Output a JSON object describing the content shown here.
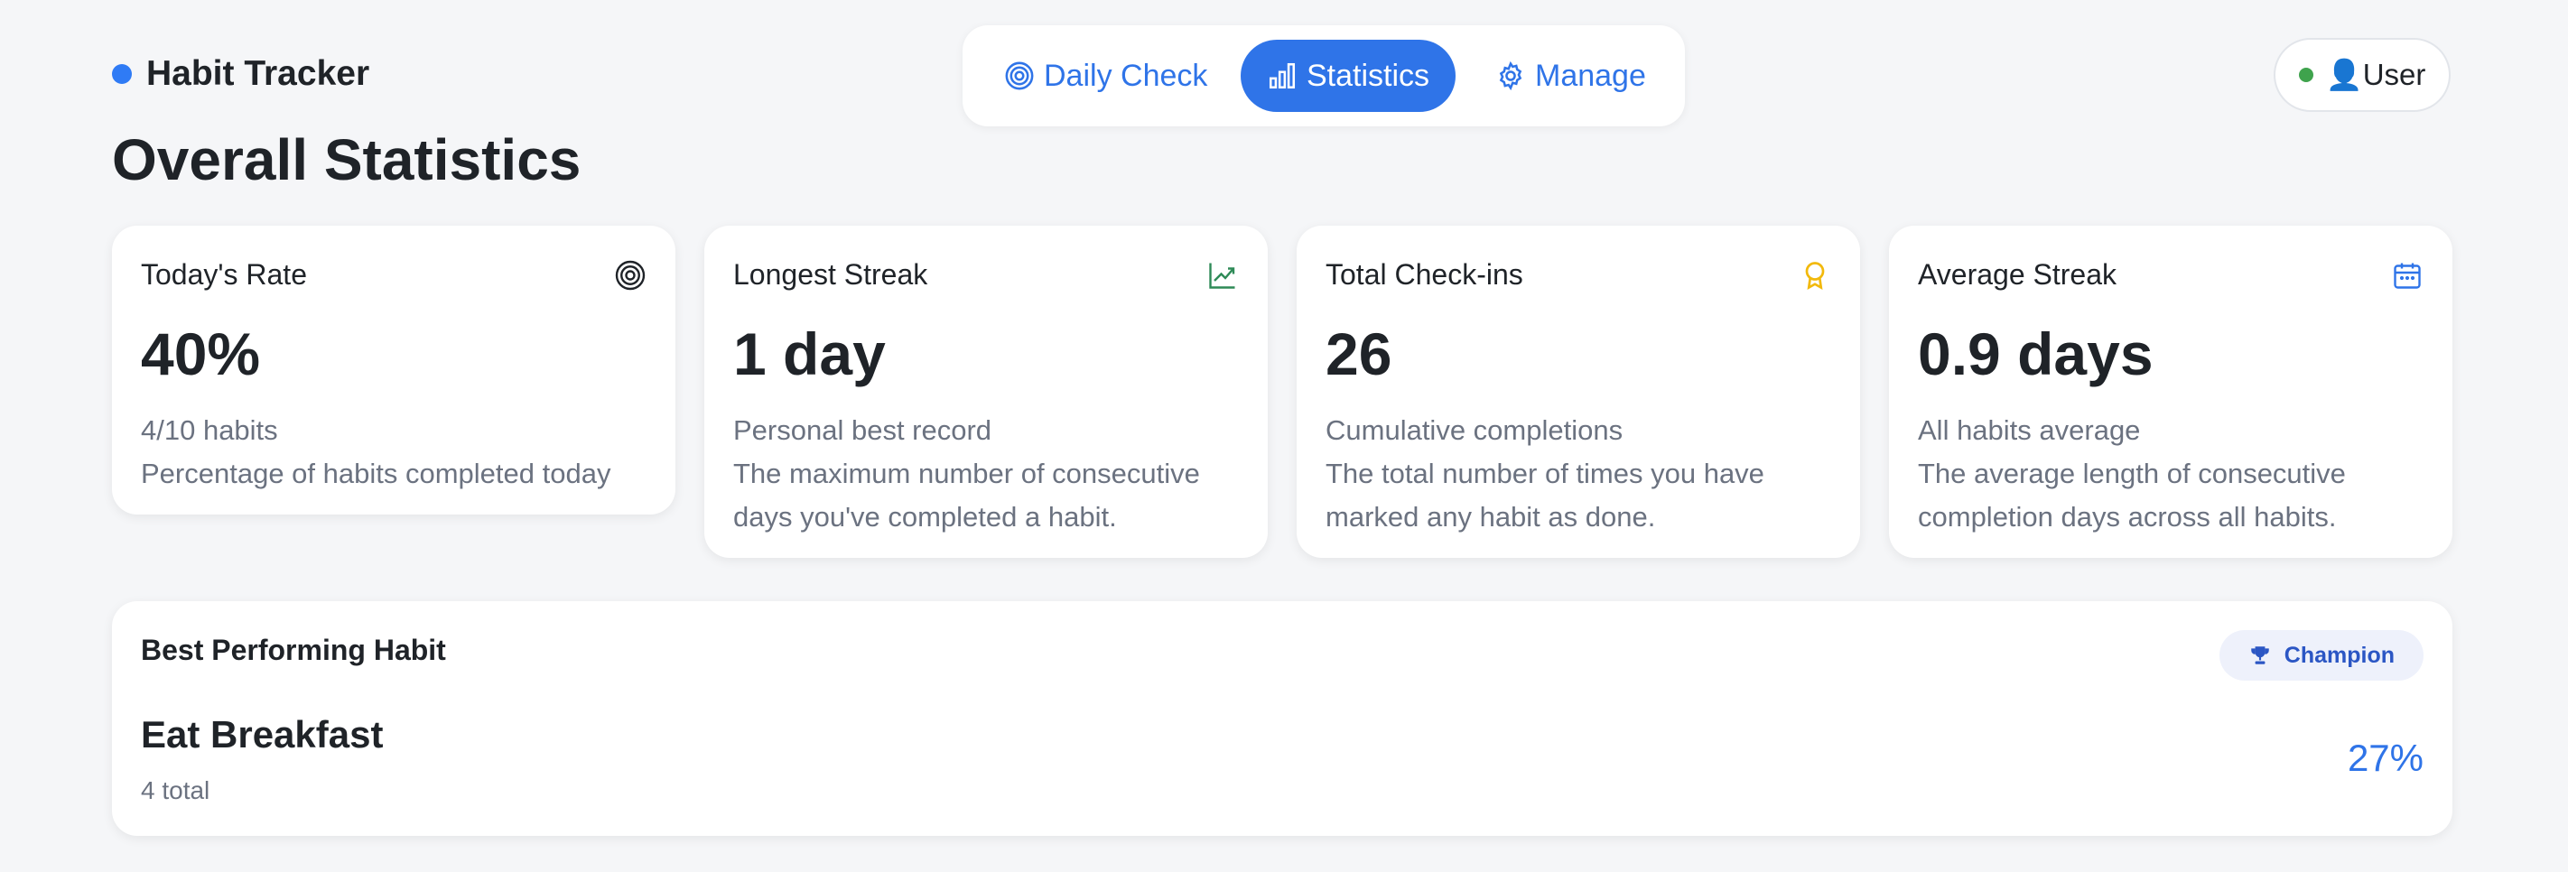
{
  "brand": {
    "name": "Habit Tracker",
    "accent": "#2f7bf5"
  },
  "nav": {
    "tabs": [
      {
        "label": "Daily Check",
        "icon": "target-icon",
        "active": false
      },
      {
        "label": "Statistics",
        "icon": "bar-chart-icon",
        "active": true
      },
      {
        "label": "Manage",
        "icon": "gear-icon",
        "active": false
      }
    ]
  },
  "user": {
    "label": "👤User",
    "status": "online",
    "status_color": "#3fa34d"
  },
  "page": {
    "title": "Overall Statistics"
  },
  "stats": [
    {
      "label": "Today's Rate",
      "icon": "target-icon",
      "value": "40%",
      "sub": "4/10 habits",
      "desc": "Percentage of habits completed today"
    },
    {
      "label": "Longest Streak",
      "icon": "trend-up-icon",
      "value": "1 day",
      "sub": "Personal best record",
      "desc": "The maximum number of consecutive days you've completed a habit."
    },
    {
      "label": "Total Check-ins",
      "icon": "award-icon",
      "value": "26",
      "sub": "Cumulative completions",
      "desc": "The total number of times you have marked any habit as done."
    },
    {
      "label": "Average Streak",
      "icon": "calendar-icon",
      "value": "0.9 days",
      "sub": "All habits average",
      "desc": "The average length of consecutive completion days across all habits."
    }
  ],
  "best": {
    "title": "Best Performing Habit",
    "badge": "Champion",
    "habit_name": "Eat Breakfast",
    "total": "4 total",
    "percent": "27%"
  },
  "colors": {
    "primary": "#2f74e8",
    "muted": "#6b7280",
    "award": "#f2b90c",
    "trend": "#2e8a57"
  }
}
